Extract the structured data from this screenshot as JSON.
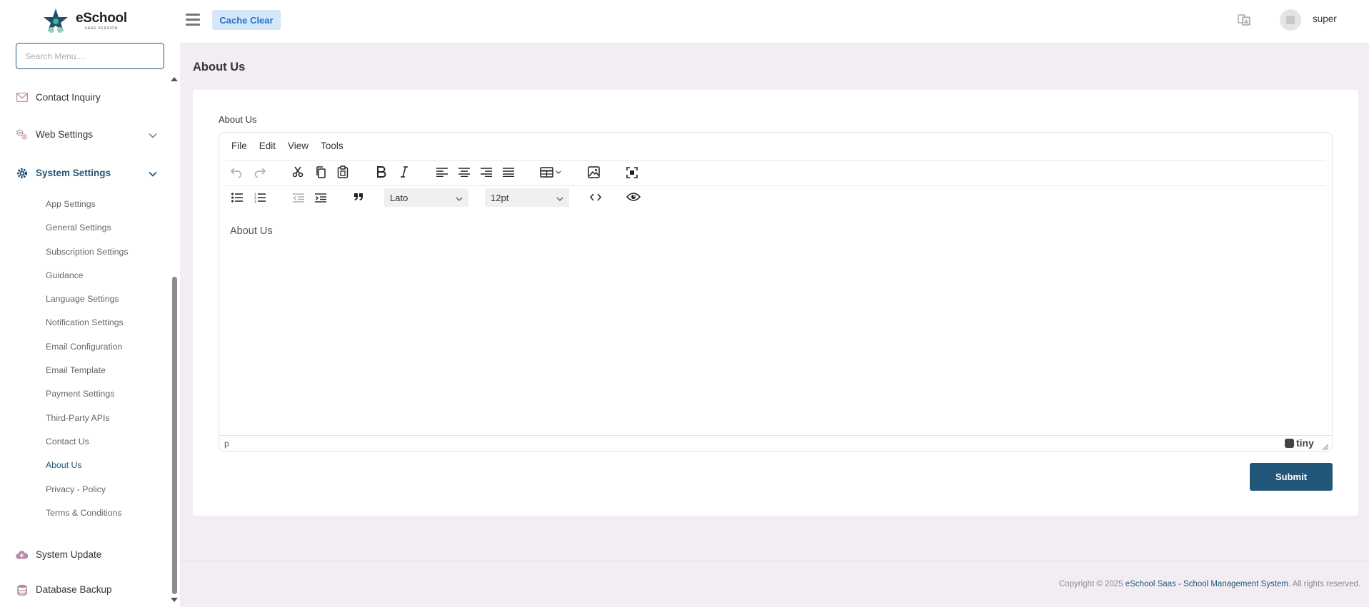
{
  "brand": {
    "name": "eSchool",
    "tagline": "SAAS VERSION"
  },
  "sidebar": {
    "search_placeholder": "Search Menu....",
    "items": [
      {
        "label": "Contact Inquiry",
        "icon": "envelope-icon"
      },
      {
        "label": "Web Settings",
        "icon": "gears-icon"
      },
      {
        "label": "System Settings",
        "icon": "gear-icon",
        "expanded": true
      },
      {
        "label": "System Update",
        "icon": "cloud-upload-icon"
      },
      {
        "label": "Database Backup",
        "icon": "database-icon"
      }
    ],
    "sub_items": [
      "App Settings",
      "General Settings",
      "Subscription Settings",
      "Guidance",
      "Language Settings",
      "Notification Settings",
      "Email Configuration",
      "Email Template",
      "Payment Settings",
      "Third-Party APIs",
      "Contact Us",
      "About Us",
      "Privacy - Policy",
      "Terms & Conditions"
    ],
    "active_sub_item": "About Us"
  },
  "header": {
    "cache_button": "Cache Clear",
    "username": "super"
  },
  "page": {
    "title": "About Us",
    "field_label": "About Us",
    "submit_label": "Submit"
  },
  "editor": {
    "menus": [
      "File",
      "Edit",
      "View",
      "Tools"
    ],
    "font_family": "Lato",
    "font_size": "12pt",
    "content": "About Us",
    "element_path": "p",
    "branding": "tiny"
  },
  "footer": {
    "prefix": "Copyright © 2025",
    "link": "eSchool Saas - School Management System",
    "suffix": ". All rights reserved."
  },
  "colors": {
    "primary": "#22577a",
    "background": "#f1edf3",
    "cache_button_bg": "#d4e7fb",
    "cache_button_text": "#2675c2"
  }
}
